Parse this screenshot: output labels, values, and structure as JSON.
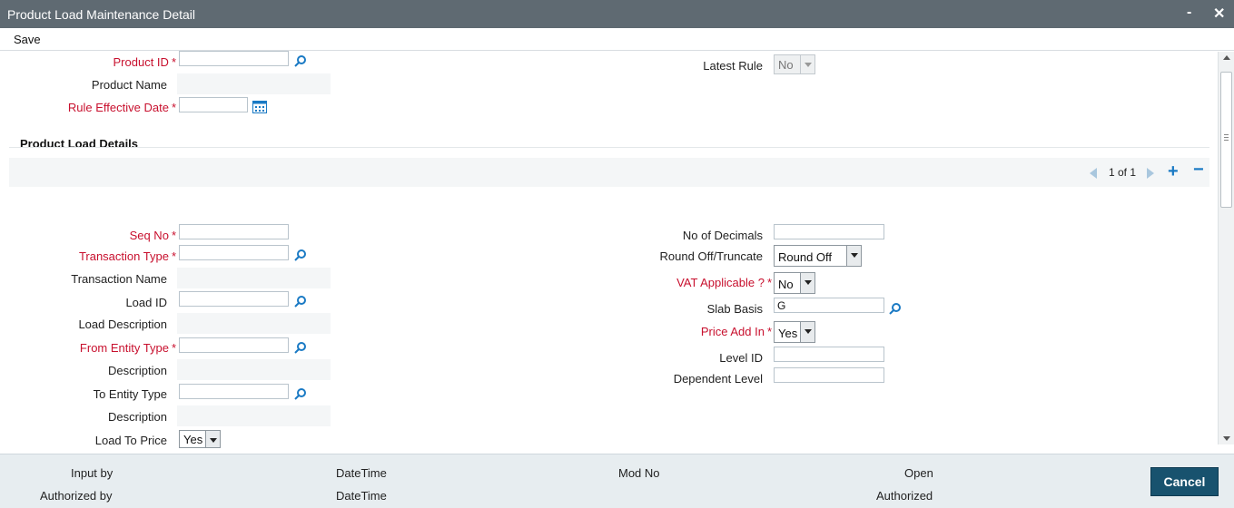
{
  "window": {
    "title": "Product Load Maintenance Detail",
    "minimize": "-",
    "close": "✕"
  },
  "toolbar": {
    "save_label": "Save"
  },
  "header": {
    "product_id_label": "Product ID",
    "product_id_value": "",
    "product_name_label": "Product Name",
    "rule_effective_date_label": "Rule Effective Date",
    "rule_effective_date_value": "",
    "latest_rule_label": "Latest Rule",
    "latest_rule_value": "No"
  },
  "section": {
    "title": "Product Load Details",
    "pager": {
      "text": "1 of 1"
    }
  },
  "left_form": {
    "seq_no_label": "Seq No",
    "transaction_type_label": "Transaction Type",
    "transaction_name_label": "Transaction Name",
    "load_id_label": "Load ID",
    "load_description_label": "Load Description",
    "from_entity_type_label": "From Entity Type",
    "description_label_1": "Description",
    "to_entity_type_label": "To Entity Type",
    "description_label_2": "Description",
    "load_to_price_label": "Load To Price",
    "load_to_price_value": "Yes"
  },
  "right_form": {
    "no_of_decimals_label": "No of Decimals",
    "round_off_label": "Round Off/Truncate",
    "round_off_value": "Round Off",
    "vat_applicable_label": "VAT Applicable ?",
    "vat_applicable_value": "No",
    "slab_basis_label": "Slab Basis",
    "slab_basis_value": "G",
    "price_add_in_label": "Price Add In",
    "price_add_in_value": "Yes",
    "level_id_label": "Level ID",
    "dependent_level_label": "Dependent Level"
  },
  "required_marker": "*",
  "footer": {
    "input_by": "Input by",
    "authorized_by": "Authorized by",
    "datetime_1": "DateTime",
    "datetime_2": "DateTime",
    "mod_no": "Mod No",
    "open": "Open",
    "authorized": "Authorized",
    "cancel_label": "Cancel"
  },
  "colors": {
    "titlebar": "#5f6a72",
    "required": "#c8102e",
    "accent": "#1a7ac4",
    "cancel_button": "#18526e"
  }
}
